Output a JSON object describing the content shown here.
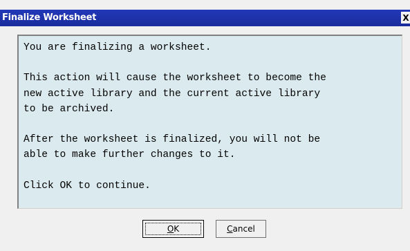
{
  "window": {
    "title": "Finalize Worksheet",
    "close_label": "X"
  },
  "message": {
    "lines": [
      "You are finalizing a worksheet.",
      "",
      "This action will cause the worksheet to become the",
      "new active library and the current active library",
      "to be archived.",
      "",
      "After the worksheet is finalized, you will not be",
      "able to make further changes to it.",
      "",
      "Click OK to continue."
    ]
  },
  "buttons": {
    "ok": {
      "mnemonic": "O",
      "rest": "K"
    },
    "cancel": {
      "mnemonic": "C",
      "rest": "ancel"
    }
  },
  "colors": {
    "titlebar": "#1c2fa8",
    "message_background": "#dbeaee",
    "dialog_background": "#f0f0f0"
  }
}
